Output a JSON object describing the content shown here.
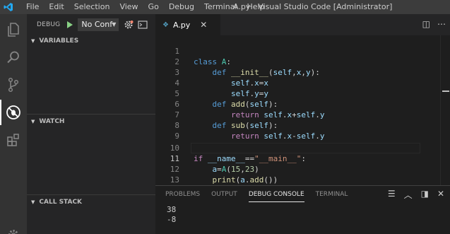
{
  "titlebar": {
    "menu": [
      "File",
      "Edit",
      "Selection",
      "View",
      "Go",
      "Debug",
      "Terminal",
      "Help"
    ],
    "title": "A.py - Visual Studio Code [Administrator]"
  },
  "activitybar": {
    "icons": [
      "explorer-icon",
      "search-icon",
      "source-control-icon",
      "debug-icon",
      "extensions-icon",
      "manage-gear-icon"
    ],
    "active": "debug-icon"
  },
  "sidebar": {
    "debug_label": "DEBUG",
    "config_value": "No Conf",
    "sections": [
      "VARIABLES",
      "WATCH",
      "CALL STACK"
    ]
  },
  "tabs": [
    {
      "label": "A.py",
      "icon": "python-file-icon"
    }
  ],
  "editor": {
    "current_line": 11,
    "lines": [
      {
        "no": "1",
        "text": "class A:"
      },
      {
        "no": "2",
        "text": "    def __init__(self,x,y):"
      },
      {
        "no": "3",
        "text": "        self.x=x"
      },
      {
        "no": "4",
        "text": "        self.y=y"
      },
      {
        "no": "5",
        "text": "    def add(self):"
      },
      {
        "no": "6",
        "text": "        return self.x+self.y"
      },
      {
        "no": "7",
        "text": "    def sub(self):"
      },
      {
        "no": "8",
        "text": "        return self.x-self.y"
      },
      {
        "no": "9",
        "text": ""
      },
      {
        "no": "10",
        "text": "if __name__==\"__main__\":"
      },
      {
        "no": "11",
        "text": "    a=A(15,23)"
      },
      {
        "no": "12",
        "text": "    print(a.add())"
      },
      {
        "no": "13",
        "text": "    print(a.sub())"
      }
    ]
  },
  "panel": {
    "tabs": [
      "PROBLEMS",
      "OUTPUT",
      "DEBUG CONSOLE",
      "TERMINAL"
    ],
    "active_tab": "DEBUG CONSOLE",
    "output": [
      "38",
      "-8"
    ]
  },
  "colors": {
    "accent": "#007acc",
    "keyword": "#569cd6",
    "string": "#ce9178",
    "number": "#b5cea8",
    "class_name": "#4ec9b0",
    "function": "#dcdcaa",
    "variable": "#9cdcfe",
    "play_green": "#89d185"
  }
}
